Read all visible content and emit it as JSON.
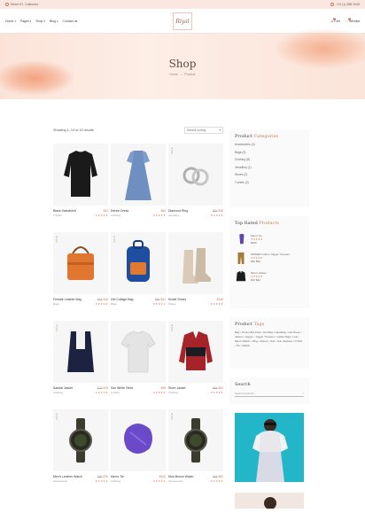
{
  "topbar": {
    "address": "Street 67, California",
    "phone": "+12 (1) 388 2949"
  },
  "nav": {
    "items": [
      "Home",
      "Pages",
      "Shop",
      "Blog",
      "Contact us"
    ]
  },
  "logo": {
    "text": "Riyal"
  },
  "header_right": {
    "cart_label": "Cart",
    "cart_count": "0",
    "wishlist_label": "Wishlist",
    "wishlist_count": "0"
  },
  "hero": {
    "title": "Shop",
    "breadcrumb_home": "Home",
    "breadcrumb_current": "Product"
  },
  "toolbar": {
    "showing": "Showing 1–13 of 15 results",
    "sort_label": "Default sorting"
  },
  "products": [
    {
      "name": "Black Sweatshirt",
      "price": "$62",
      "old": "",
      "cat": "T-shirts",
      "badge": "",
      "icon": "sweatshirt-icon"
    },
    {
      "name": "Denim Dress",
      "price": "$65",
      "old": "",
      "cat": "Clothing",
      "badge": "",
      "icon": "dress-icon"
    },
    {
      "name": "Diamond Ring",
      "price": "$48",
      "old": "$59",
      "cat": "Jewellery",
      "badge": "SALE",
      "icon": "ring-icon"
    },
    {
      "name": "Female Leather Bag",
      "price": "$18",
      "old": "$24",
      "cat": "Bags",
      "badge": "SALE",
      "icon": "handbag-icon"
    },
    {
      "name": "Girl Collage Bag",
      "price": "$31",
      "old": "$60",
      "cat": "Bags",
      "badge": "SALE",
      "icon": "backpack-icon"
    },
    {
      "name": "Kickel Shoes",
      "price": "$248",
      "old": "",
      "cat": "Shoes",
      "badge": "",
      "icon": "boots-icon"
    },
    {
      "name": "Sandal Jacket",
      "price": "$78",
      "old": "$22",
      "cat": "Clothing",
      "badge": "SALE",
      "icon": "vest-icon"
    },
    {
      "name": "Sax White Tshirt",
      "price": "$98",
      "old": "",
      "cat": "T-shirts",
      "badge": "",
      "icon": "tshirt-icon"
    },
    {
      "name": "Short Jacket",
      "price": "$62",
      "old": "$68",
      "cat": "Clothing",
      "badge": "SALE",
      "icon": "jacket-icon"
    },
    {
      "name": "Men's Leather Watch",
      "price": "$76",
      "old": "$85",
      "cat": "Accessories",
      "badge": "SALE",
      "icon": "watch-icon"
    },
    {
      "name": "Men's Tie",
      "price": "$200",
      "old": "",
      "cat": "Clothing",
      "badge": "",
      "icon": "tie-icon"
    },
    {
      "name": "Mud Brown Watch",
      "price": "$82",
      "old": "$65",
      "cat": "Accessories",
      "badge": "SALE",
      "icon": "watch-icon"
    }
  ],
  "sidebar": {
    "categories_title_a": "Product",
    "categories_title_b": "Categories",
    "categories": [
      "Accessories (4)",
      "Bags (3)",
      "Clothing (8)",
      "Jewellery (1)",
      "Shoes (2)",
      "T-shirts (2)"
    ],
    "top_title_a": "Top Rated",
    "top_title_b": "Products",
    "top_rated": [
      {
        "name": "Men's Tie",
        "price": "$200"
      },
      {
        "name": "WOMEN Cotton Jogger Trousers",
        "price": "$60 $52"
      },
      {
        "name": "Men's Jacket",
        "price": "$16 $12"
      }
    ],
    "tags_title_a": "Product",
    "tags_title_b": "Tags",
    "tags": "Bag  •  Denim Bra Pant  •  Girl Bag  •  Handbag  •  Hot Dress  •  Jacket  •  Jogger  •  Jogger Trousers  •  Ladies Bag  •  Lets  •  Men's Watch  •  Ring  •  Shoes  •  Suit  •  Sun Glasses  •  T-Shirt  •  Tie  •  Watch",
    "search_title": "Search",
    "search_placeholder": "Search products..."
  },
  "colors": {
    "accent": "#d0795f",
    "hero": "#fbe3d8"
  }
}
